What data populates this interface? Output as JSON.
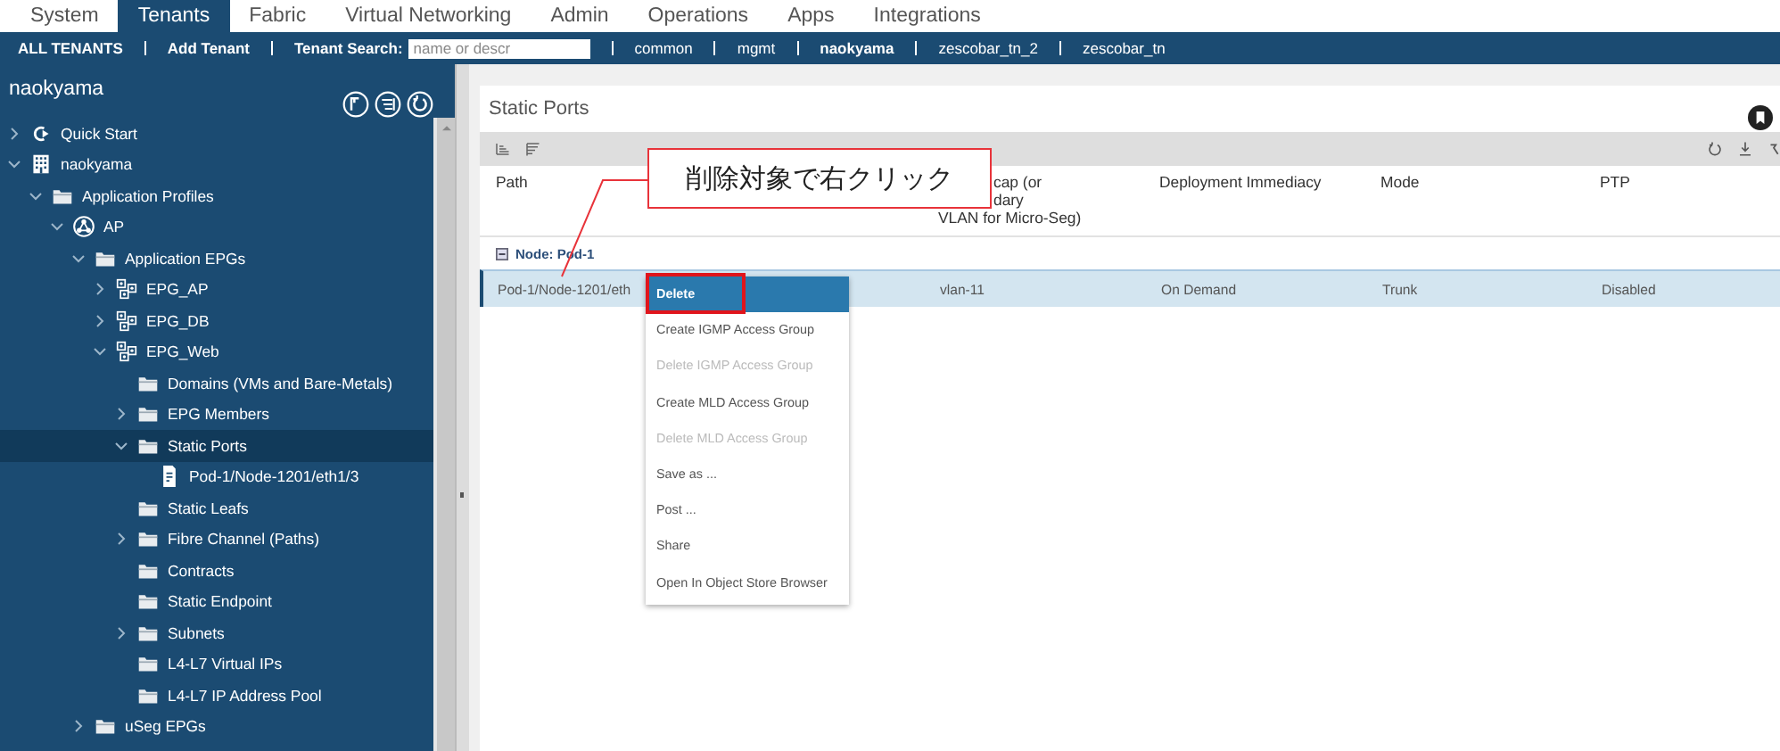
{
  "top_tabs": [
    {
      "label": "System",
      "selected": false
    },
    {
      "label": "Tenants",
      "selected": true
    },
    {
      "label": "Fabric",
      "selected": false
    },
    {
      "label": "Virtual Networking",
      "selected": false
    },
    {
      "label": "Admin",
      "selected": false
    },
    {
      "label": "Operations",
      "selected": false
    },
    {
      "label": "Apps",
      "selected": false
    },
    {
      "label": "Integrations",
      "selected": false
    }
  ],
  "sub_nav": {
    "all_tenants": "ALL TENANTS",
    "add_tenant": "Add Tenant",
    "search_label": "Tenant Search:",
    "search_placeholder": "name or descr",
    "tenants": [
      {
        "label": "common",
        "selected": false
      },
      {
        "label": "mgmt",
        "selected": false
      },
      {
        "label": "naokyama",
        "selected": true
      },
      {
        "label": "zescobar_tn_2",
        "selected": false
      },
      {
        "label": "zescobar_tn",
        "selected": false
      }
    ]
  },
  "sidebar": {
    "title": "naokyama",
    "tree": [
      {
        "label": "Quick Start",
        "kind": "quickstart",
        "expandable": true,
        "expanded": false,
        "selected": false
      },
      {
        "label": "naokyama",
        "kind": "tenant",
        "expandable": true,
        "expanded": true,
        "selected": false,
        "children": [
          {
            "label": "Application Profiles",
            "kind": "folder",
            "expandable": true,
            "expanded": true,
            "selected": false,
            "children": [
              {
                "label": "AP",
                "kind": "profile",
                "expandable": true,
                "expanded": true,
                "selected": false,
                "children": [
                  {
                    "label": "Application EPGs",
                    "kind": "folder",
                    "expandable": true,
                    "expanded": true,
                    "selected": false,
                    "children": [
                      {
                        "label": "EPG_AP",
                        "kind": "epg",
                        "expandable": true,
                        "expanded": false,
                        "selected": false
                      },
                      {
                        "label": "EPG_DB",
                        "kind": "epg",
                        "expandable": true,
                        "expanded": false,
                        "selected": false
                      },
                      {
                        "label": "EPG_Web",
                        "kind": "epg",
                        "expandable": true,
                        "expanded": true,
                        "selected": false,
                        "children": [
                          {
                            "label": "Domains (VMs and Bare-Metals)",
                            "kind": "folder",
                            "expandable": false,
                            "selected": false
                          },
                          {
                            "label": "EPG Members",
                            "kind": "folder",
                            "expandable": true,
                            "expanded": false,
                            "selected": false
                          },
                          {
                            "label": "Static Ports",
                            "kind": "folder",
                            "expandable": true,
                            "expanded": true,
                            "selected": true,
                            "children": [
                              {
                                "label": "Pod-1/Node-1201/eth1/3",
                                "kind": "document",
                                "expandable": false,
                                "selected": false
                              }
                            ]
                          },
                          {
                            "label": "Static Leafs",
                            "kind": "folder",
                            "expandable": false,
                            "selected": false
                          },
                          {
                            "label": "Fibre Channel (Paths)",
                            "kind": "folder",
                            "expandable": true,
                            "expanded": false,
                            "selected": false
                          },
                          {
                            "label": "Contracts",
                            "kind": "folder",
                            "expandable": false,
                            "selected": false
                          },
                          {
                            "label": "Static Endpoint",
                            "kind": "folder",
                            "expandable": false,
                            "selected": false
                          },
                          {
                            "label": "Subnets",
                            "kind": "folder",
                            "expandable": true,
                            "expanded": false,
                            "selected": false
                          },
                          {
                            "label": "L4-L7 Virtual IPs",
                            "kind": "folder",
                            "expandable": false,
                            "selected": false
                          },
                          {
                            "label": "L4-L7 IP Address Pool",
                            "kind": "folder",
                            "expandable": false,
                            "selected": false
                          }
                        ]
                      }
                    ]
                  },
                  {
                    "label": "uSeg EPGs",
                    "kind": "folder",
                    "expandable": true,
                    "expanded": false,
                    "selected": false
                  }
                ]
              }
            ]
          }
        ]
      }
    ]
  },
  "panel": {
    "title": "Static Ports",
    "table": {
      "columns": [
        {
          "lines": [
            "Path"
          ]
        },
        {
          "lines": [
            "cap (or",
            "dary",
            "VLAN for Micro-Seg)"
          ]
        },
        {
          "lines": [
            "Deployment Immediacy"
          ]
        },
        {
          "lines": [
            "Mode"
          ]
        },
        {
          "lines": [
            "PTP"
          ]
        }
      ],
      "group": "Node: Pod-1",
      "rows": [
        {
          "cells": [
            "Pod-1/Node-1201/eth",
            "vlan-11",
            "On Demand",
            "Trunk",
            "Disabled"
          ],
          "selected": true
        }
      ]
    }
  },
  "context_menu": [
    {
      "label": "Delete",
      "selected": true,
      "disabled": false
    },
    {
      "label": "Create IGMP Access Group",
      "selected": false,
      "disabled": false
    },
    {
      "label": "Delete IGMP Access Group",
      "selected": false,
      "disabled": true
    },
    {
      "label": "Create MLD Access Group",
      "selected": false,
      "disabled": false
    },
    {
      "label": "Delete MLD Access Group",
      "selected": false,
      "disabled": true
    },
    {
      "label": "Save as ...",
      "selected": false,
      "disabled": false
    },
    {
      "label": "Post ...",
      "selected": false,
      "disabled": false
    },
    {
      "label": "Share",
      "selected": false,
      "disabled": false
    },
    {
      "label": "Open In Object Store Browser",
      "selected": false,
      "disabled": false
    }
  ],
  "callout": "削除対象で右クリック"
}
